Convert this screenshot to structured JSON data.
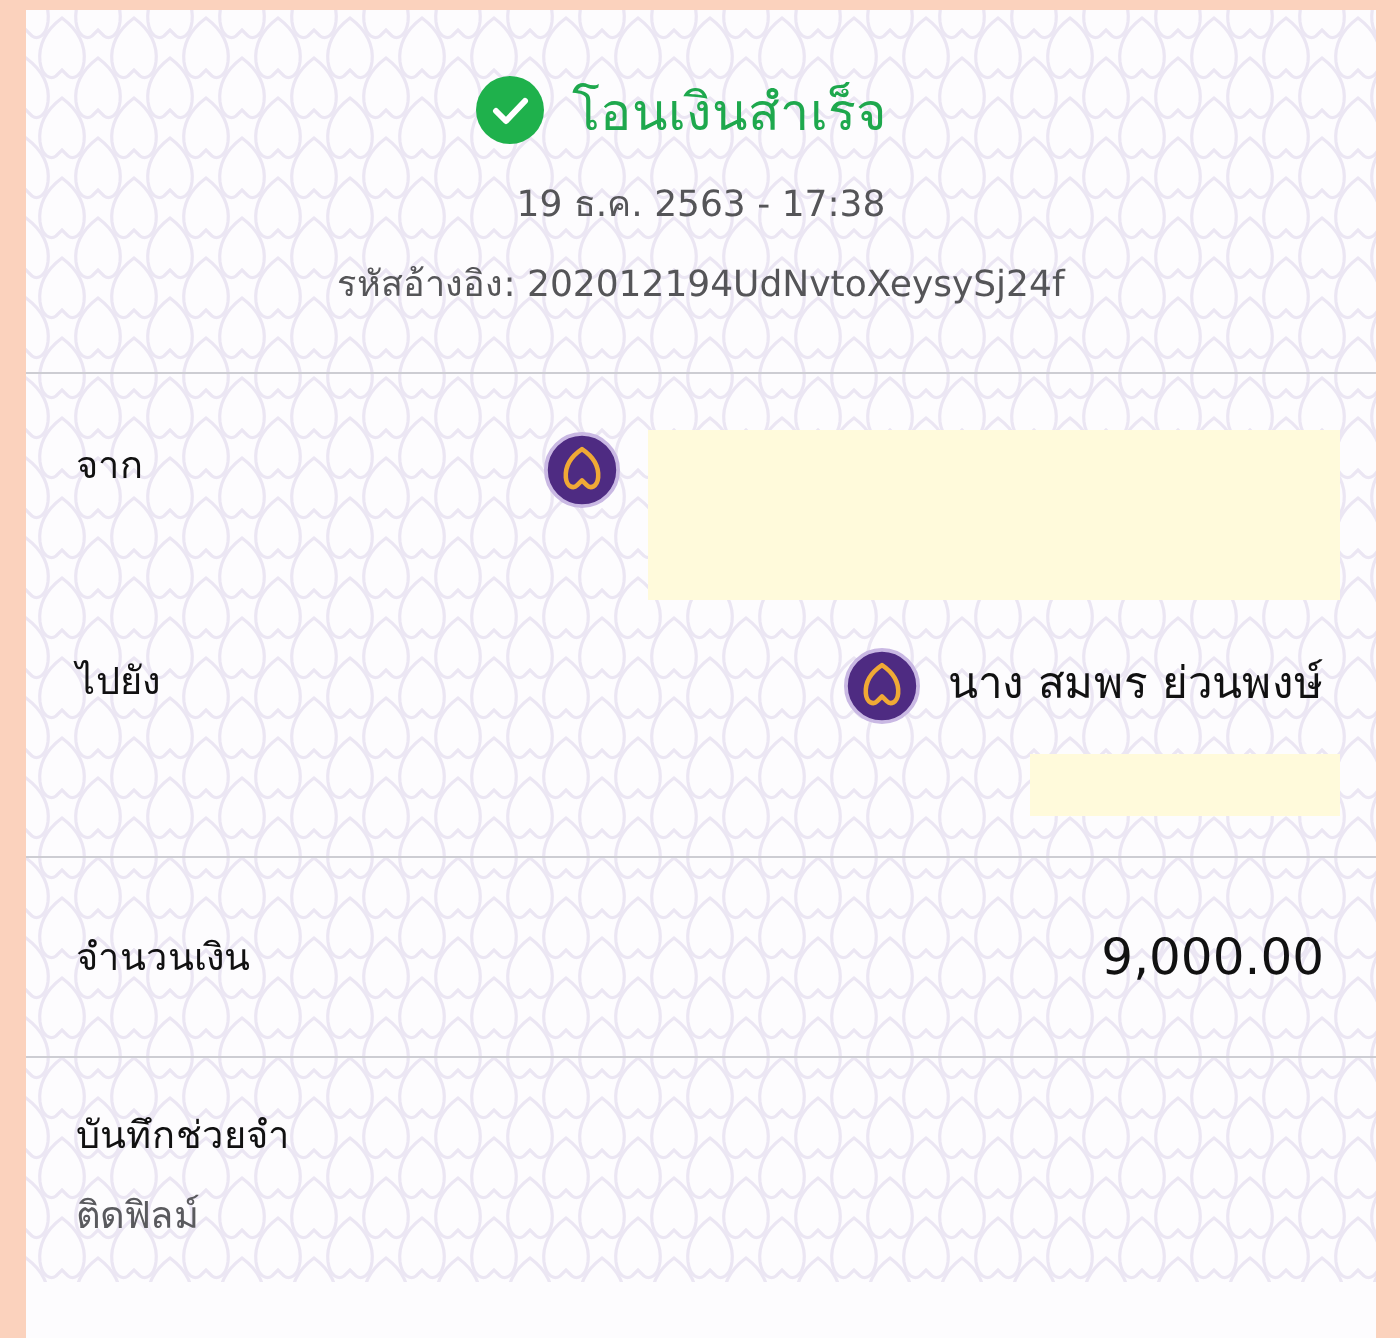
{
  "title": "โอนเงินสำเร็จ",
  "datetime": "19 ธ.ค. 2563 - 17:38",
  "reference": "รหัสอ้างอิง: 202012194UdNvtoXeysySj24f",
  "parties": [
    {
      "label": "จาก",
      "redacted": true
    },
    {
      "label": "ไปยัง",
      "name": "นาง สมพร ย่วนพงษ์",
      "redacted": true
    }
  ],
  "amount": {
    "label": "จำนวนเงิน",
    "value": "9,000.00"
  },
  "memo": {
    "label": "บันทึกช่วยจำ",
    "value": "ติดฟิลม์"
  }
}
